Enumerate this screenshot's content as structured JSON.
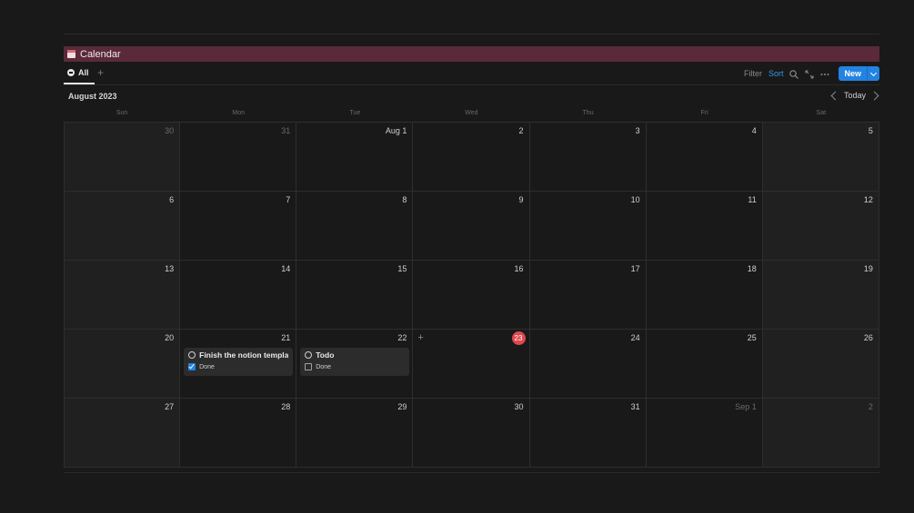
{
  "header": {
    "title": "Calendar"
  },
  "toolbar": {
    "tab_label": "All",
    "filter_label": "Filter",
    "sort_label": "Sort",
    "new_label": "New"
  },
  "calendar": {
    "month_label": "August 2023",
    "today_label": "Today",
    "weekdays": [
      "Sun",
      "Mon",
      "Tue",
      "Wed",
      "Thu",
      "Fri",
      "Sat"
    ],
    "weeks": [
      [
        "30",
        "31",
        "Aug 1",
        "2",
        "3",
        "4",
        "5"
      ],
      [
        "6",
        "7",
        "8",
        "9",
        "10",
        "11",
        "12"
      ],
      [
        "13",
        "14",
        "15",
        "16",
        "17",
        "18",
        "19"
      ],
      [
        "20",
        "21",
        "22",
        "23",
        "24",
        "25",
        "26"
      ],
      [
        "27",
        "28",
        "29",
        "30",
        "31",
        "Sep 1",
        "2"
      ]
    ],
    "events": [
      {
        "title": "Finish the notion templa...",
        "prop_label": "Done",
        "done": true
      },
      {
        "title": "Todo",
        "prop_label": "Done",
        "done": false
      }
    ]
  },
  "colors": {
    "title_bar": "#5a2a3a",
    "accent": "#2383e2",
    "today": "#e0474f"
  }
}
